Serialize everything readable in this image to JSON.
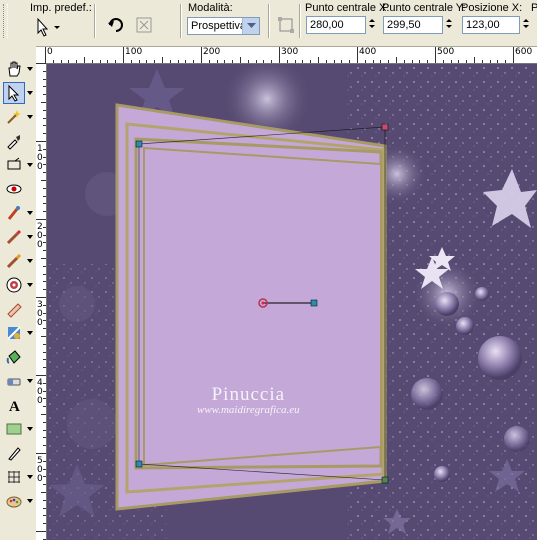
{
  "options_bar": {
    "preset_label": "Imp. predef.:",
    "mode_label": "Modalità:",
    "mode_value": "Prospettiva",
    "center_x_label": "Punto centrale X:",
    "center_x_value": "280,00",
    "center_y_label": "Punto centrale Y:",
    "center_y_value": "299,50",
    "position_x_label": "Posizione X:",
    "position_x_value": "123,00",
    "truncated_label": "P"
  },
  "ruler": {
    "h_labels": [
      "0",
      "100",
      "200",
      "300",
      "400",
      "500",
      "600"
    ],
    "v_labels": [
      "1",
      "0",
      "0",
      "2",
      "0",
      "0",
      "3",
      "0",
      "0",
      "4",
      "0",
      "0",
      "5",
      "0",
      "0"
    ]
  },
  "toolbar": {
    "tools": [
      "pan-icon",
      "pick-tool-icon",
      "magic-wand-icon",
      "dropper-icon",
      "crop-icon",
      "red-eye-icon",
      "clone-brush-icon",
      "paint-brush-icon",
      "lighten-brush-icon",
      "target-tool-icon",
      "eraser-brush-icon",
      "picture-tube-icon",
      "flood-fill-icon",
      "background-eraser-icon",
      "text-tool-icon",
      "rectangle-icon",
      "pen-tool-icon",
      "mesh-warp-icon",
      "art-media-icon"
    ]
  },
  "watermark": {
    "name": "Pinuccia",
    "url": "www.maidiregrafica.eu"
  },
  "colors": {
    "canvas_bg": "#564a72",
    "frame_fill": "#c4a9d8",
    "frame_border": "#a89a64",
    "handle": "#2a8cb0"
  }
}
